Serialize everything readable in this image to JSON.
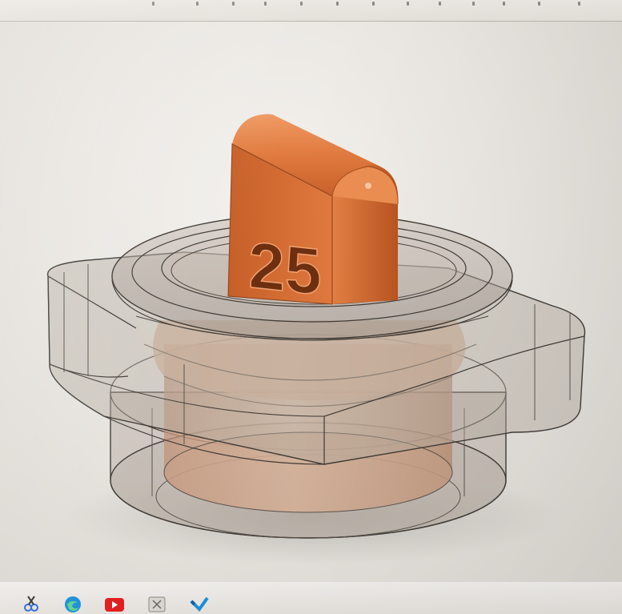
{
  "model": {
    "engraving": "25",
    "colors": {
      "tab": "#d9733a",
      "tab_dark": "#b4551f",
      "housing_fill": "#a99f96",
      "housing_edge": "#3f3a35",
      "core": "#d2a88c"
    }
  },
  "taskbar": {
    "icons": [
      "snipping-tool-icon",
      "edge-browser-icon",
      "youtube-icon",
      "app-icon",
      "vs-code-icon"
    ]
  }
}
